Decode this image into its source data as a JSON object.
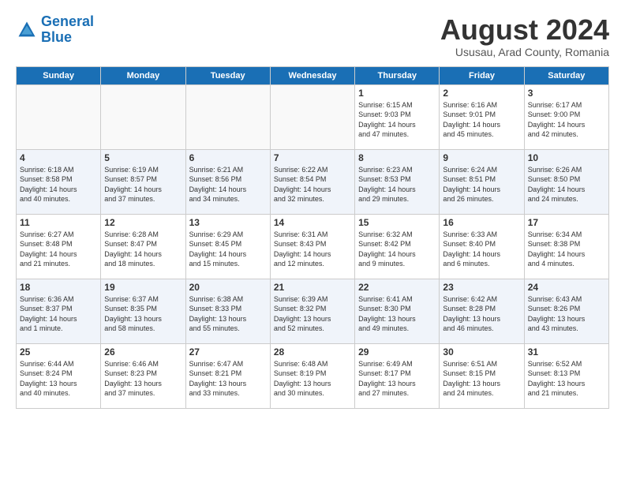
{
  "header": {
    "logo_line1": "General",
    "logo_line2": "Blue",
    "main_title": "August 2024",
    "subtitle": "Ususau, Arad County, Romania"
  },
  "days_of_week": [
    "Sunday",
    "Monday",
    "Tuesday",
    "Wednesday",
    "Thursday",
    "Friday",
    "Saturday"
  ],
  "weeks": [
    [
      {
        "day": "",
        "info": ""
      },
      {
        "day": "",
        "info": ""
      },
      {
        "day": "",
        "info": ""
      },
      {
        "day": "",
        "info": ""
      },
      {
        "day": "1",
        "info": "Sunrise: 6:15 AM\nSunset: 9:03 PM\nDaylight: 14 hours\nand 47 minutes."
      },
      {
        "day": "2",
        "info": "Sunrise: 6:16 AM\nSunset: 9:01 PM\nDaylight: 14 hours\nand 45 minutes."
      },
      {
        "day": "3",
        "info": "Sunrise: 6:17 AM\nSunset: 9:00 PM\nDaylight: 14 hours\nand 42 minutes."
      }
    ],
    [
      {
        "day": "4",
        "info": "Sunrise: 6:18 AM\nSunset: 8:58 PM\nDaylight: 14 hours\nand 40 minutes."
      },
      {
        "day": "5",
        "info": "Sunrise: 6:19 AM\nSunset: 8:57 PM\nDaylight: 14 hours\nand 37 minutes."
      },
      {
        "day": "6",
        "info": "Sunrise: 6:21 AM\nSunset: 8:56 PM\nDaylight: 14 hours\nand 34 minutes."
      },
      {
        "day": "7",
        "info": "Sunrise: 6:22 AM\nSunset: 8:54 PM\nDaylight: 14 hours\nand 32 minutes."
      },
      {
        "day": "8",
        "info": "Sunrise: 6:23 AM\nSunset: 8:53 PM\nDaylight: 14 hours\nand 29 minutes."
      },
      {
        "day": "9",
        "info": "Sunrise: 6:24 AM\nSunset: 8:51 PM\nDaylight: 14 hours\nand 26 minutes."
      },
      {
        "day": "10",
        "info": "Sunrise: 6:26 AM\nSunset: 8:50 PM\nDaylight: 14 hours\nand 24 minutes."
      }
    ],
    [
      {
        "day": "11",
        "info": "Sunrise: 6:27 AM\nSunset: 8:48 PM\nDaylight: 14 hours\nand 21 minutes."
      },
      {
        "day": "12",
        "info": "Sunrise: 6:28 AM\nSunset: 8:47 PM\nDaylight: 14 hours\nand 18 minutes."
      },
      {
        "day": "13",
        "info": "Sunrise: 6:29 AM\nSunset: 8:45 PM\nDaylight: 14 hours\nand 15 minutes."
      },
      {
        "day": "14",
        "info": "Sunrise: 6:31 AM\nSunset: 8:43 PM\nDaylight: 14 hours\nand 12 minutes."
      },
      {
        "day": "15",
        "info": "Sunrise: 6:32 AM\nSunset: 8:42 PM\nDaylight: 14 hours\nand 9 minutes."
      },
      {
        "day": "16",
        "info": "Sunrise: 6:33 AM\nSunset: 8:40 PM\nDaylight: 14 hours\nand 6 minutes."
      },
      {
        "day": "17",
        "info": "Sunrise: 6:34 AM\nSunset: 8:38 PM\nDaylight: 14 hours\nand 4 minutes."
      }
    ],
    [
      {
        "day": "18",
        "info": "Sunrise: 6:36 AM\nSunset: 8:37 PM\nDaylight: 14 hours\nand 1 minute."
      },
      {
        "day": "19",
        "info": "Sunrise: 6:37 AM\nSunset: 8:35 PM\nDaylight: 13 hours\nand 58 minutes."
      },
      {
        "day": "20",
        "info": "Sunrise: 6:38 AM\nSunset: 8:33 PM\nDaylight: 13 hours\nand 55 minutes."
      },
      {
        "day": "21",
        "info": "Sunrise: 6:39 AM\nSunset: 8:32 PM\nDaylight: 13 hours\nand 52 minutes."
      },
      {
        "day": "22",
        "info": "Sunrise: 6:41 AM\nSunset: 8:30 PM\nDaylight: 13 hours\nand 49 minutes."
      },
      {
        "day": "23",
        "info": "Sunrise: 6:42 AM\nSunset: 8:28 PM\nDaylight: 13 hours\nand 46 minutes."
      },
      {
        "day": "24",
        "info": "Sunrise: 6:43 AM\nSunset: 8:26 PM\nDaylight: 13 hours\nand 43 minutes."
      }
    ],
    [
      {
        "day": "25",
        "info": "Sunrise: 6:44 AM\nSunset: 8:24 PM\nDaylight: 13 hours\nand 40 minutes."
      },
      {
        "day": "26",
        "info": "Sunrise: 6:46 AM\nSunset: 8:23 PM\nDaylight: 13 hours\nand 37 minutes."
      },
      {
        "day": "27",
        "info": "Sunrise: 6:47 AM\nSunset: 8:21 PM\nDaylight: 13 hours\nand 33 minutes."
      },
      {
        "day": "28",
        "info": "Sunrise: 6:48 AM\nSunset: 8:19 PM\nDaylight: 13 hours\nand 30 minutes."
      },
      {
        "day": "29",
        "info": "Sunrise: 6:49 AM\nSunset: 8:17 PM\nDaylight: 13 hours\nand 27 minutes."
      },
      {
        "day": "30",
        "info": "Sunrise: 6:51 AM\nSunset: 8:15 PM\nDaylight: 13 hours\nand 24 minutes."
      },
      {
        "day": "31",
        "info": "Sunrise: 6:52 AM\nSunset: 8:13 PM\nDaylight: 13 hours\nand 21 minutes."
      }
    ]
  ]
}
